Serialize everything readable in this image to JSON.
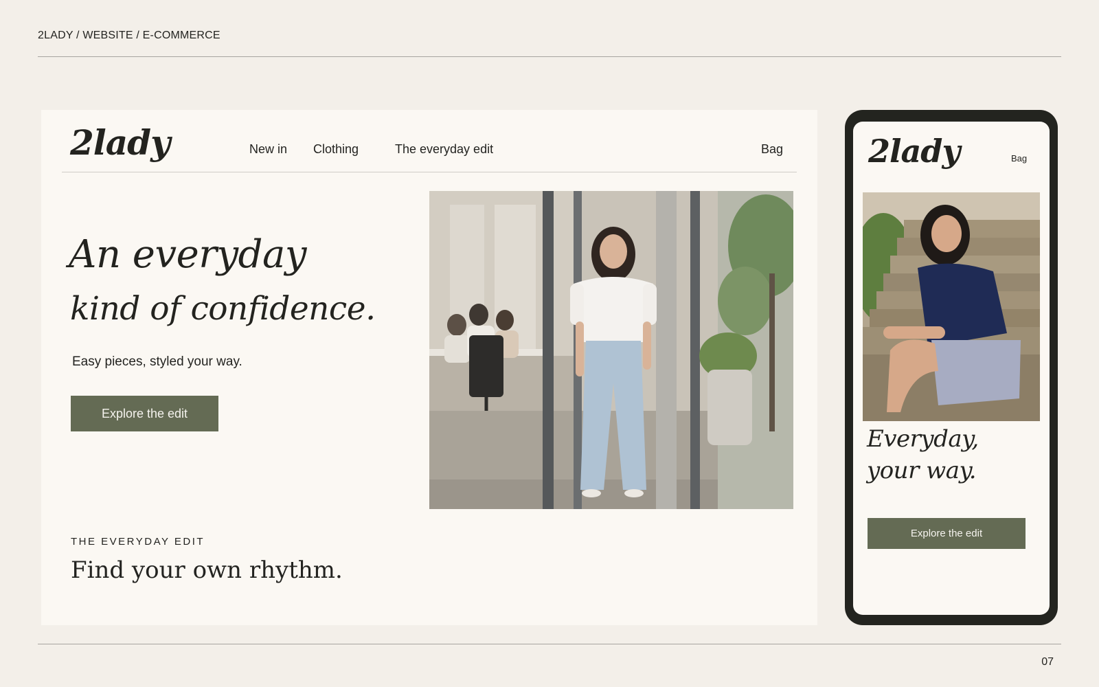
{
  "header": {
    "breadcrumb": "2LADY / WEBSITE / E-COMMERCE",
    "page_number": "07"
  },
  "desktop": {
    "logo": "2lady",
    "nav": [
      "New in",
      "Clothing",
      "The everyday edit"
    ],
    "bag": "Bag",
    "hero": {
      "headline_line1": "An everyday",
      "headline_line2": "kind of confidence.",
      "subheading": "Easy pieces, styled your way.",
      "cta": "Explore the edit"
    },
    "section": {
      "eyebrow": "THE EVERYDAY EDIT",
      "title": "Find your own rhythm."
    }
  },
  "mobile": {
    "logo": "2lady",
    "bag": "Bag",
    "headline_line1": "Everyday,",
    "headline_line2": "your way.",
    "cta": "Explore the edit"
  },
  "colors": {
    "page_background": "#f3efe9",
    "card_background": "#fbf8f3",
    "accent_button": "#646b54",
    "phone_frame": "#23241f",
    "text": "#232320"
  }
}
